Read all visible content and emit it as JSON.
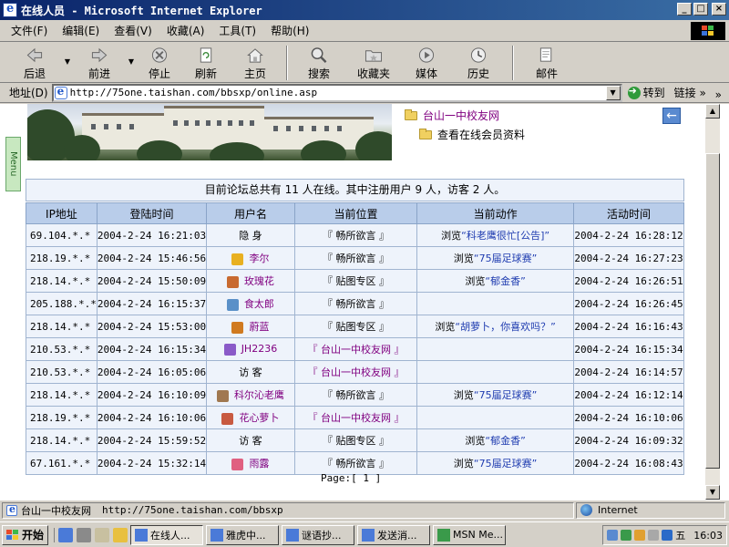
{
  "window": {
    "title": "在线人员 - Microsoft Internet Explorer",
    "buttons": {
      "minimize": "_",
      "maximize": "□",
      "close": "×"
    }
  },
  "menu": [
    "文件(F)",
    "编辑(E)",
    "查看(V)",
    "收藏(A)",
    "工具(T)",
    "帮助(H)"
  ],
  "toolbar": {
    "back": "后退",
    "forward": "前进",
    "stop": "停止",
    "refresh": "刷新",
    "home": "主页",
    "search": "搜索",
    "favorites": "收藏夹",
    "media": "媒体",
    "history": "历史",
    "mail": "邮件",
    "more": "»"
  },
  "address": {
    "label": "地址(D)",
    "url": "http://75one.taishan.com/bbsxp/online.asp",
    "go": "转到",
    "links": "链接"
  },
  "page": {
    "menu_tab": "Menu",
    "site_link": "台山一中校友网",
    "member_info": "查看在线会员资料",
    "back_arrow": "←",
    "summary": "目前论坛总共有 11 人在线。其中注册用户 9 人，访客 2 人。",
    "columns": [
      "IP地址",
      "登陆时间",
      "用户名",
      "当前位置",
      "当前动作",
      "活动时间"
    ],
    "rows": [
      {
        "ip": "69.104.*.*",
        "login": "2004-2-24 16:21:03",
        "user": "隐 身",
        "avatar": "",
        "location": "『 畅所欲言 』",
        "action_prefix": "浏览",
        "action_topic": "“科老鹰很忙[公告]”",
        "active": "2004-2-24 16:28:12"
      },
      {
        "ip": "218.19.*.*",
        "login": "2004-2-24 15:46:56",
        "user": "李尔",
        "avatar": "#e8b020",
        "location": "『 畅所欲言 』",
        "action_prefix": "浏览",
        "action_topic": "“75届足球赛”",
        "active": "2004-2-24 16:27:23"
      },
      {
        "ip": "218.14.*.*",
        "login": "2004-2-24 15:50:09",
        "user": "玫瑰花",
        "avatar": "#c86a30",
        "location": "『 贴图专区 』",
        "action_prefix": "浏览",
        "action_topic": "“郁金香”",
        "active": "2004-2-24 16:26:51"
      },
      {
        "ip": "205.188.*.*",
        "login": "2004-2-24 16:15:37",
        "user": "食太郎",
        "avatar": "#5a90c8",
        "location": "『 畅所欲言 』",
        "action_prefix": "",
        "action_topic": "",
        "active": "2004-2-24 16:26:45"
      },
      {
        "ip": "218.14.*.*",
        "login": "2004-2-24 15:53:00",
        "user": "蔚蓝",
        "avatar": "#d07a20",
        "location": "『 贴图专区 』",
        "action_prefix": "浏览",
        "action_topic": "“胡萝卜，你喜欢吗？”",
        "active": "2004-2-24 16:16:43"
      },
      {
        "ip": "210.53.*.*",
        "login": "2004-2-24 16:15:34",
        "user": "JH2236",
        "avatar": "#8a5ac8",
        "location": "『 台山一中校友网 』",
        "action_prefix": "",
        "action_topic": "",
        "active": "2004-2-24 16:15:34"
      },
      {
        "ip": "210.53.*.*",
        "login": "2004-2-24 16:05:06",
        "user": "访 客",
        "avatar": "",
        "location": "『 台山一中校友网 』",
        "action_prefix": "",
        "action_topic": "",
        "active": "2004-2-24 16:14:57"
      },
      {
        "ip": "218.14.*.*",
        "login": "2004-2-24 16:10:09",
        "user": "科尔沁老鹰",
        "avatar": "#a07850",
        "location": "『 畅所欲言 』",
        "action_prefix": "浏览",
        "action_topic": "“75届足球赛”",
        "active": "2004-2-24 16:12:14"
      },
      {
        "ip": "218.19.*.*",
        "login": "2004-2-24 16:10:06",
        "user": "花心萝卜",
        "avatar": "#c85a40",
        "location": "『 台山一中校友网 』",
        "action_prefix": "",
        "action_topic": "",
        "active": "2004-2-24 16:10:06"
      },
      {
        "ip": "218.14.*.*",
        "login": "2004-2-24 15:59:52",
        "user": "访 客",
        "avatar": "",
        "location": "『 贴图专区 』",
        "action_prefix": "浏览",
        "action_topic": "“郁金香”",
        "active": "2004-2-24 16:09:32"
      },
      {
        "ip": "67.161.*.*",
        "login": "2004-2-24 15:32:14",
        "user": "雨露",
        "avatar": "#e06080",
        "location": "『 畅所欲言 』",
        "action_prefix": "浏览",
        "action_topic": "“75届足球赛”",
        "active": "2004-2-24 16:08:43"
      }
    ],
    "pager": "Page:[ 1 ]"
  },
  "status": {
    "title": "台山一中校友网",
    "url": "http://75one.taishan.com/bbsxp",
    "zone": "Internet"
  },
  "taskbar": {
    "start": "开始",
    "tasks": [
      "在线人...",
      "雅虎中...",
      "谜语抄...",
      "发送消...",
      "MSN Me..."
    ],
    "tray_letter": "五",
    "clock": "16:03"
  }
}
